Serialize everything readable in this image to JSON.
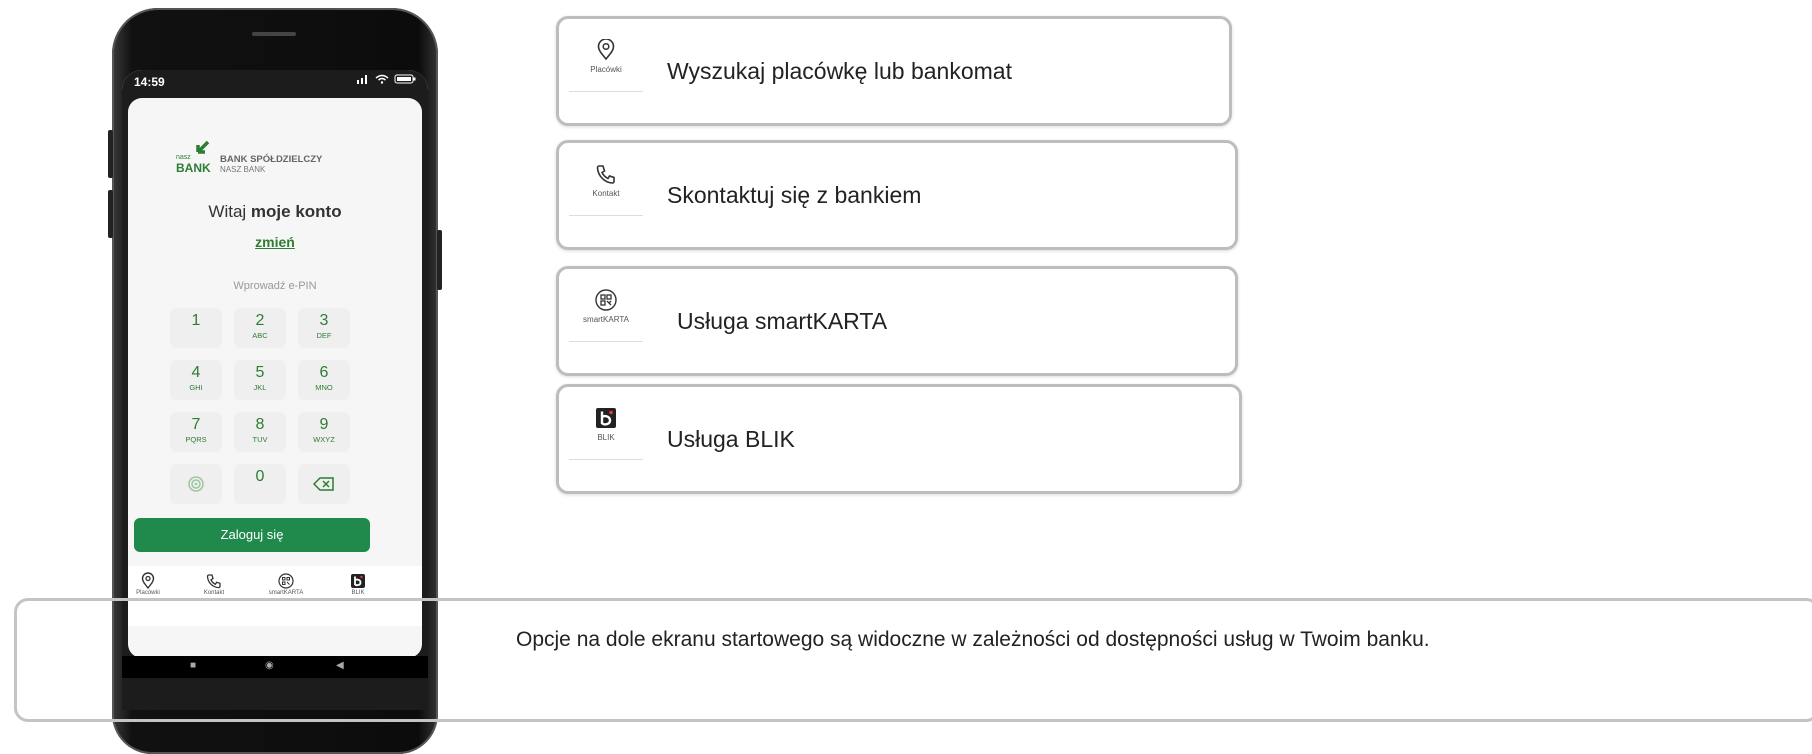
{
  "phone": {
    "status_time": "14:59",
    "bank_brand_small": "nasz",
    "bank_brand": "BANK",
    "bank_name": "BANK SPÓŁDZIELCZY",
    "bank_subname": "NASZ BANK",
    "greeting_prefix": "Witaj",
    "greeting_name": "moje konto",
    "change_link": "zmień",
    "pin_hint": "Wprowadź e-PIN",
    "keys": [
      {
        "digit": "1",
        "letters": ""
      },
      {
        "digit": "2",
        "letters": "ABC"
      },
      {
        "digit": "3",
        "letters": "DEF"
      },
      {
        "digit": "4",
        "letters": "GHI"
      },
      {
        "digit": "5",
        "letters": "JKL"
      },
      {
        "digit": "6",
        "letters": "MNO"
      },
      {
        "digit": "7",
        "letters": "PQRS"
      },
      {
        "digit": "8",
        "letters": "TUV"
      },
      {
        "digit": "9",
        "letters": "WXYZ"
      },
      {
        "digit": "0",
        "letters": ""
      }
    ],
    "login_button": "Zaloguj się",
    "nav": [
      {
        "label": "Placówki",
        "icon": "location-pin-icon"
      },
      {
        "label": "Kontakt",
        "icon": "phone-icon"
      },
      {
        "label": "smartKARTA",
        "icon": "smartkarta-icon"
      },
      {
        "label": "BLIK",
        "icon": "blik-icon"
      }
    ]
  },
  "callouts": [
    {
      "caption": "Placówki",
      "text": "Wyszukaj placówkę lub bankomat",
      "icon": "location-pin-icon"
    },
    {
      "caption": "Kontakt",
      "text": "Skontaktuj się z bankiem",
      "icon": "phone-icon"
    },
    {
      "caption": "smartKARTA",
      "text": "Usługa smartKARTA",
      "icon": "smartkarta-icon"
    },
    {
      "caption": "BLIK",
      "text": "Usługa BLIK",
      "icon": "blik-icon"
    }
  ],
  "note": "Opcje na dole ekranu startowego są widoczne w zależności od dostępności usług w Twoim banku.",
  "colors": {
    "accent": "#1f8a4c",
    "brand_green": "#2e7d32",
    "frame_gray": "#bdbdbd"
  }
}
